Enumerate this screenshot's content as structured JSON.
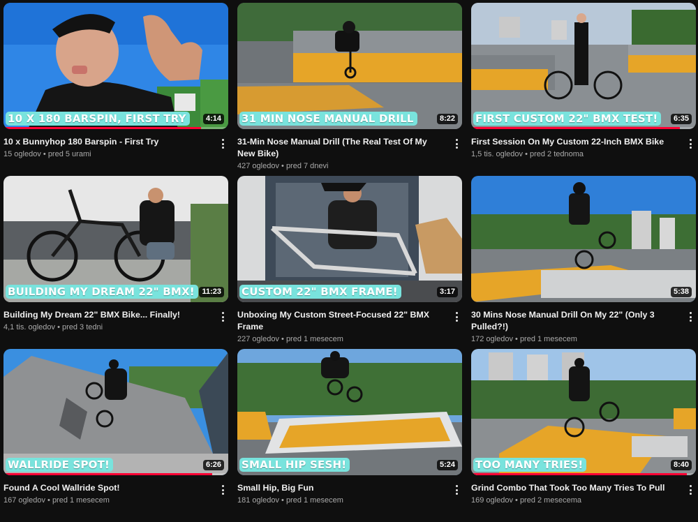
{
  "colors": {
    "background": "#0f0f0f",
    "title": "#f1f1f1",
    "meta": "#aaaaaa",
    "overlay_badge": "#79e3dd",
    "progress": "#ff0033"
  },
  "videos": [
    {
      "overlay": "10 x 180 BARSPIN, FIRST TRY",
      "duration": "4:14",
      "title": "10 x Bunnyhop 180 Barspin - First Try",
      "views": "15 ogledov",
      "age": "pred 5 urami",
      "watched": 0.88
    },
    {
      "overlay": "31 MIN NOSE MANUAL DRILL",
      "duration": "8:22",
      "title": "31-Min Nose Manual Drill (The Real Test Of My New Bike)",
      "views": "427 ogledov",
      "age": "pred 7 dnevi",
      "watched": 0
    },
    {
      "overlay": "FIRST CUSTOM 22\" BMX TEST!",
      "duration": "6:35",
      "title": "First Session On My Custom 22-Inch BMX Bike",
      "views": "1,5 tis. ogledov",
      "age": "pred 2 tednoma",
      "watched": 0.93
    },
    {
      "overlay": "BUILDING MY DREAM 22\" BMX!",
      "duration": "11:23",
      "title": "Building My Dream 22\" BMX Bike... Finally!",
      "views": "4,1 tis. ogledov",
      "age": "pred 3 tedni",
      "watched": 0
    },
    {
      "overlay": "CUSTOM 22\" BMX FRAME!",
      "duration": "3:17",
      "title": "Unboxing My Custom Street-Focused 22\" BMX Frame",
      "views": "227 ogledov",
      "age": "pred 1 mesecem",
      "watched": 0
    },
    {
      "overlay": "",
      "duration": "5:38",
      "title": "30 Mins Nose Manual Drill On My 22\" (Only 3 Pulled?!)",
      "views": "172 ogledov",
      "age": "pred 1 mesecem",
      "watched": 0
    },
    {
      "overlay": "WALLRIDE SPOT!",
      "duration": "6:26",
      "title": "Found A Cool Wallride Spot!",
      "views": "167 ogledov",
      "age": "pred 1 mesecem",
      "watched": 0.93
    },
    {
      "overlay": "SMALL HIP SESH!",
      "duration": "5:24",
      "title": "Small Hip, Big Fun",
      "views": "181 ogledov",
      "age": "pred 1 mesecem",
      "watched": 0
    },
    {
      "overlay": "TOO MANY TRIES!",
      "duration": "8:40",
      "title": "Grind Combo That Took Too Many Tries To Pull",
      "views": "169 ogledov",
      "age": "pred 2 mesecema",
      "watched": 0.96
    }
  ],
  "separator": "•",
  "more_actions_icon": "more-vertical-icon"
}
